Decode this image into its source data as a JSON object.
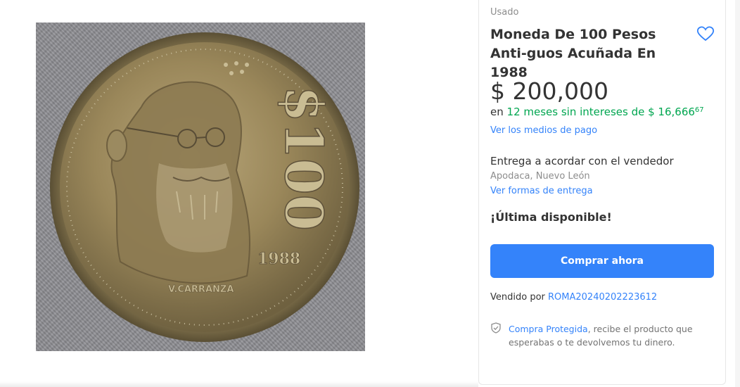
{
  "gallery": {
    "image_icon": "coin-photo",
    "coin_denomination": "$100",
    "coin_year": "1988",
    "coin_name": "V.CARRANZA"
  },
  "product": {
    "condition": "Usado",
    "title": "Moneda De 100 Pesos Anti-guos Acuñada En 1988",
    "favorite_icon": "heart-outline-icon",
    "price": "$ 200,000",
    "installments": {
      "prefix": "en",
      "months_text": "12 meses sin intereses de",
      "amount": "$ 16,666",
      "cents": "67"
    },
    "payment_link": "Ver los medios de pago",
    "delivery": "Entrega a acordar con el vendedor",
    "location": "Apodaca, Nuevo León",
    "delivery_link": "Ver formas de entrega",
    "stock": "¡Última disponible!",
    "buy_label": "Comprar ahora",
    "seller_prefix": "Vendido por",
    "seller_name": "ROMA20240202223612",
    "protection_icon": "shield-check-icon",
    "protection_link": "Compra Protegida",
    "protection_text": ", recibe el producto que esperabas o te devolvemos tu dinero."
  },
  "colors": {
    "accent": "#3483fa",
    "installment_green": "#00a650",
    "text": "#333333",
    "muted": "#8c8c8c"
  }
}
